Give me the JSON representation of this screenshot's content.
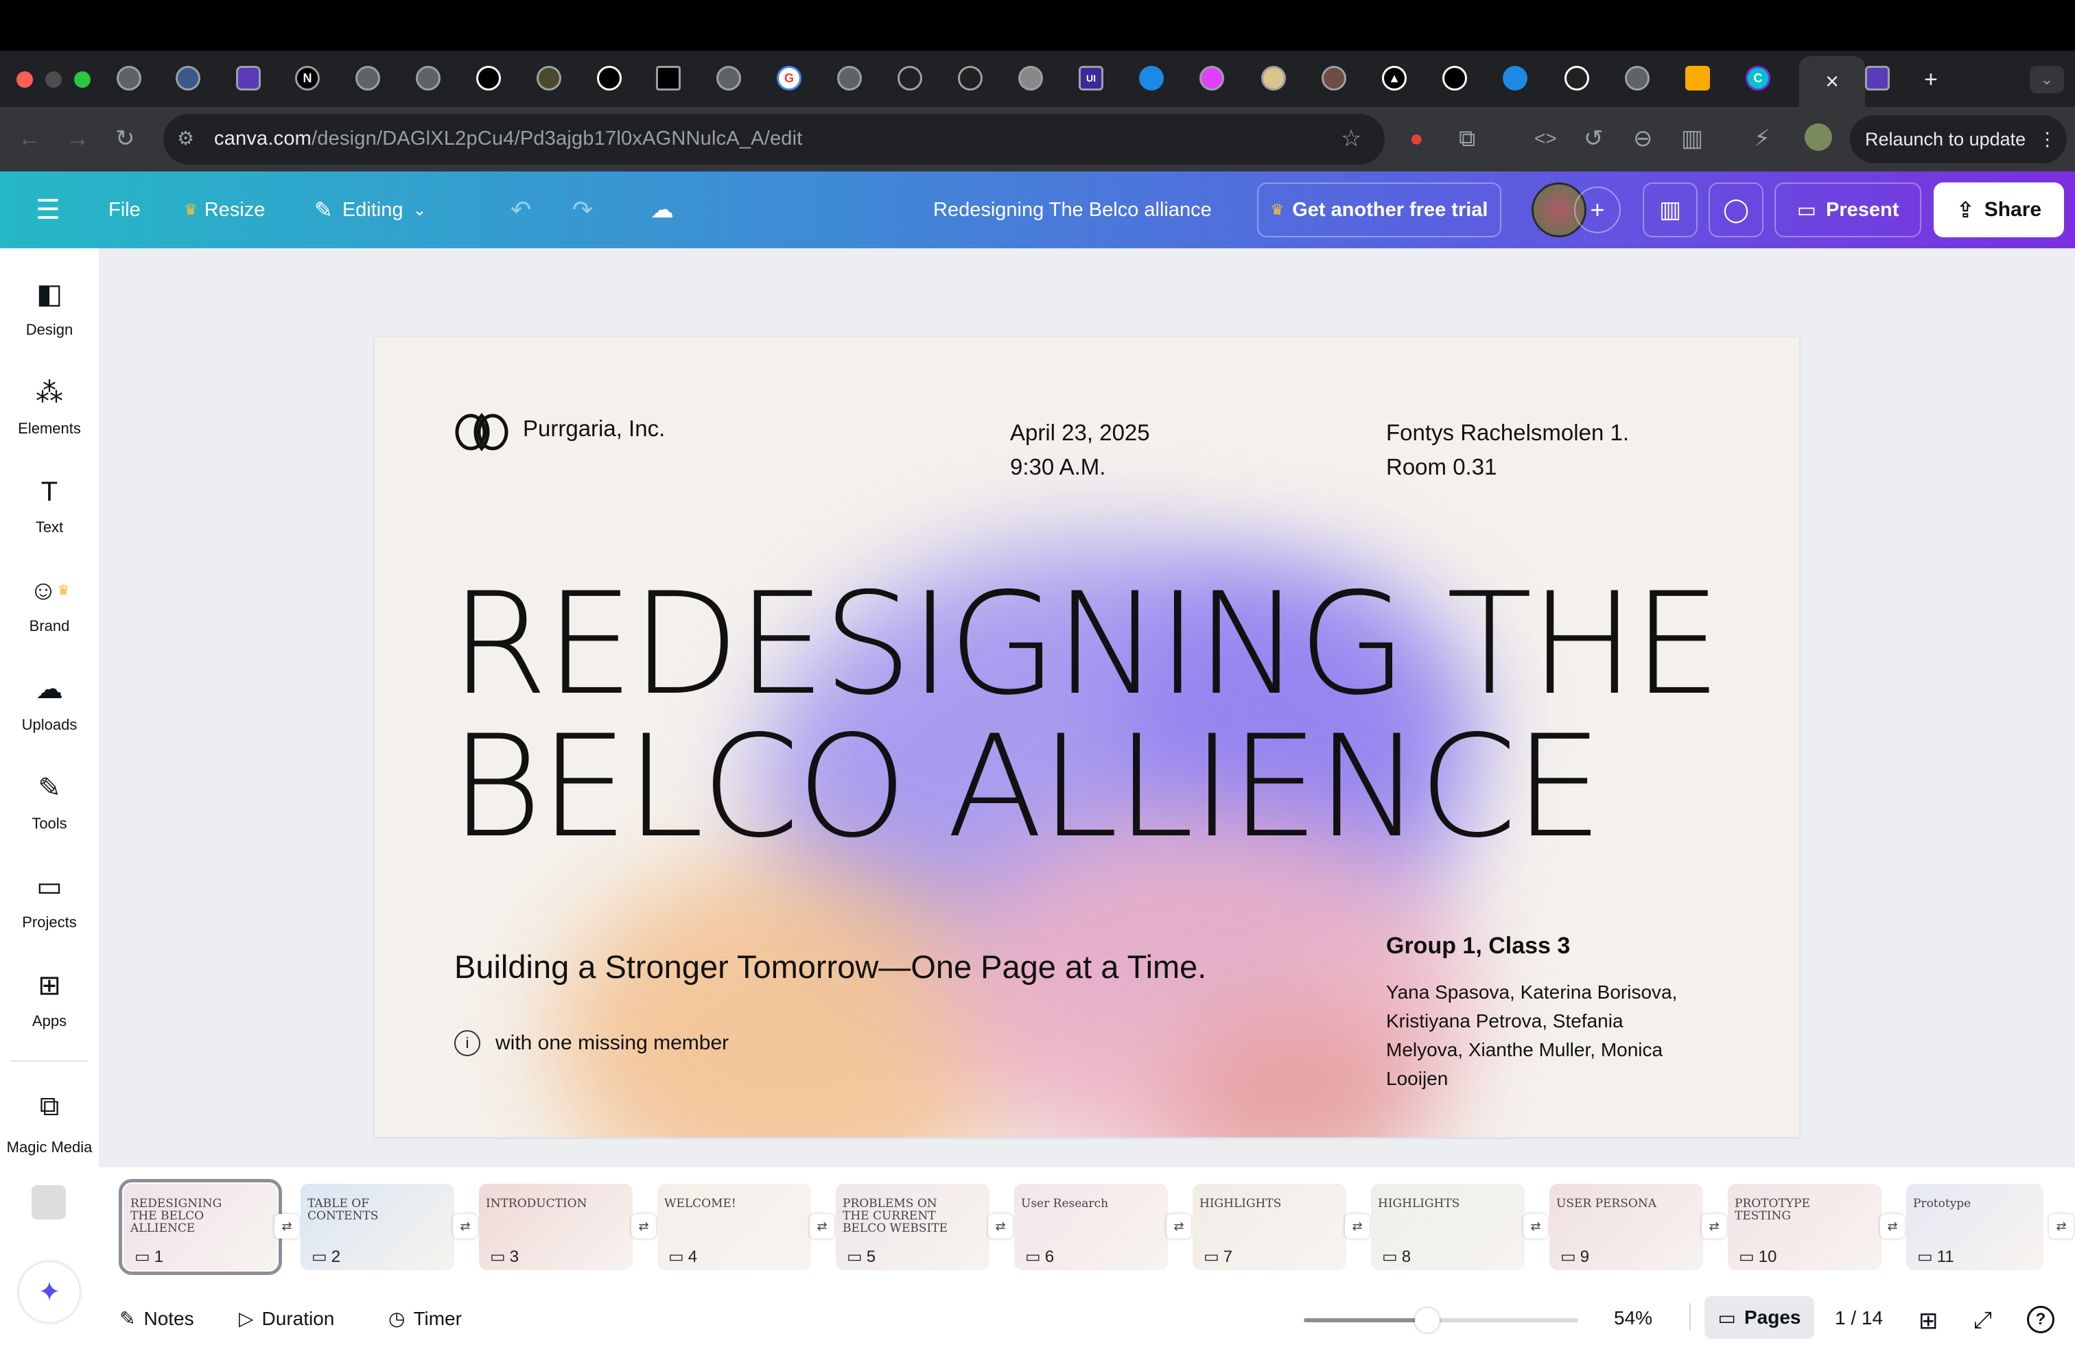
{
  "browser": {
    "url_host": "canva.com",
    "url_path": "/design/DAGlXL2pCu4/Pd3ajgb17l0xAGNNulcA_A/edit",
    "relaunch_label": "Relaunch to update",
    "active_tab_close": "×",
    "new_tab": "+"
  },
  "header": {
    "file": "File",
    "resize": "Resize",
    "editing": "Editing",
    "doc_title": "Redesigning The Belco alliance",
    "trial": "Get another free trial",
    "present": "Present",
    "share": "Share"
  },
  "sidebar": [
    {
      "label": "Design",
      "icon": "design-icon"
    },
    {
      "label": "Elements",
      "icon": "elements-icon"
    },
    {
      "label": "Text",
      "icon": "text-icon"
    },
    {
      "label": "Brand",
      "icon": "brand-icon"
    },
    {
      "label": "Uploads",
      "icon": "uploads-icon"
    },
    {
      "label": "Tools",
      "icon": "tools-icon"
    },
    {
      "label": "Projects",
      "icon": "projects-icon"
    },
    {
      "label": "Apps",
      "icon": "apps-icon"
    },
    {
      "label": "Magic Media",
      "icon": "magic-media-icon"
    }
  ],
  "slide": {
    "company": "Purrgaria, Inc.",
    "date": "April 23, 2025",
    "time": "9:30 A.M.",
    "location_line1": "Fontys Rachelsmolen 1.",
    "location_line2": "Room 0.31",
    "title_line1": "REDESIGNING THE",
    "title_line2": "BELCO ALLIENCE",
    "subtitle": "Building a Stronger Tomorrow—One Page at a Time.",
    "note": "with one missing member",
    "group": "Group 1, Class 3",
    "members": [
      "Yana Spasova, Katerina Borisova,",
      "Kristiyana Petrova, Stefania",
      "Melyova, Xianthe Muller, Monica",
      "Looijen"
    ]
  },
  "thumbnails": [
    {
      "num": "1",
      "title": "REDESIGNING THE BELCO ALLIENCE",
      "bg": "#efe3ea"
    },
    {
      "num": "2",
      "title": "TABLE OF CONTENTS",
      "bg": "#d9e6f2"
    },
    {
      "num": "3",
      "title": "INTRODUCTION",
      "bg": "#f0d8d6"
    },
    {
      "num": "4",
      "title": "WELCOME!",
      "bg": "#f4efe9"
    },
    {
      "num": "5",
      "title": "PROBLEMS ON THE CURRENT BELCO WEBSITE",
      "bg": "#efe7ea"
    },
    {
      "num": "6",
      "title": "User Research",
      "bg": "#f3e6ea"
    },
    {
      "num": "7",
      "title": "HIGHLIGHTS",
      "bg": "#f1ece6"
    },
    {
      "num": "8",
      "title": "HIGHLIGHTS",
      "bg": "#eef0ea"
    },
    {
      "num": "9",
      "title": "USER PERSONA",
      "bg": "#f0dfe2"
    },
    {
      "num": "10",
      "title": "PROTOTYPE TESTING",
      "bg": "#f1e4e6"
    },
    {
      "num": "11",
      "title": "Prototype",
      "bg": "#e6e8f3"
    }
  ],
  "footer": {
    "notes": "Notes",
    "duration": "Duration",
    "timer": "Timer",
    "zoom": "54%",
    "zoom_fraction": 0.45,
    "pages": "Pages",
    "page_counter": "1 / 14",
    "help": "?"
  },
  "colors": {
    "header_gradient_start": "#25b8c6",
    "header_gradient_end": "#7b2fe0",
    "blob_purple": "#9d8ef0",
    "blob_orange": "#f3c08e",
    "blob_pink": "#efb3c4"
  }
}
